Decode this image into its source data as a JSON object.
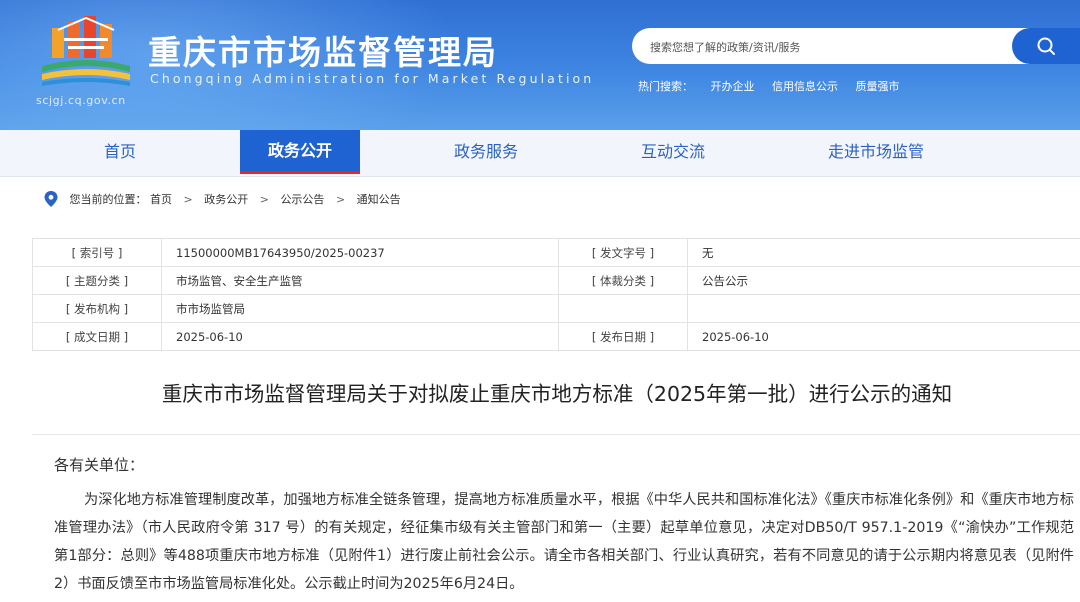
{
  "header": {
    "site_title": "重庆市市场监督管理局",
    "site_subtitle": "Chongqing Administration for Market Regulation",
    "site_url": "scjgj.cq.gov.cn",
    "logo_icon": "chongqing-city-logo-icon",
    "colors": {
      "header_blue": "#3f86e2",
      "button_blue": "#1f63d2",
      "active_underline": "#e22a22"
    }
  },
  "search": {
    "placeholder": "搜索您想了解的政策/资讯/服务",
    "value": "",
    "button_icon": "search-icon"
  },
  "hot_search": {
    "label": "热门搜索：",
    "items": [
      "开办企业",
      "信用信息公示",
      "质量强市"
    ]
  },
  "nav": {
    "items": [
      {
        "label": "首页",
        "active": false
      },
      {
        "label": "政务公开",
        "active": true
      },
      {
        "label": "政务服务",
        "active": false
      },
      {
        "label": "互动交流",
        "active": false
      },
      {
        "label": "走进市场监管",
        "active": false
      }
    ]
  },
  "breadcrumb": {
    "icon": "location-pin-icon",
    "prefix": "您当前的位置：",
    "items": [
      "首页",
      "政务公开",
      "公示公告",
      "通知公告"
    ],
    "separator": ">"
  },
  "meta": {
    "rows": [
      {
        "k1": "[ 索引号 ]",
        "v1": "11500000MB17643950/2025-00237",
        "k2": "[ 发文字号 ]",
        "v2": "无"
      },
      {
        "k1": "[ 主题分类 ]",
        "v1": "市场监管、安全生产监管",
        "k2": "[ 体裁分类 ]",
        "v2": "公告公示"
      },
      {
        "k1": "[ 发布机构 ]",
        "v1": "市市场监管局",
        "k2": "",
        "v2": ""
      },
      {
        "k1": "[ 成文日期 ]",
        "v1": "2025-06-10",
        "k2": "[ 发布日期 ]",
        "v2": "2025-06-10"
      }
    ]
  },
  "article": {
    "title": "重庆市市场监督管理局关于对拟废止重庆市地方标准（2025年第一批）进行公示的通知",
    "salutation": "各有关单位：",
    "paragraph": "为深化地方标准管理制度改革，加强地方标准全链条管理，提高地方标准质量水平，根据《中华人民共和国标准化法》《重庆市标准化条例》和《重庆市地方标准管理办法》（市人民政府令第 317 号）的有关规定，经征集市级有关主管部门和第一（主要）起草单位意见，决定对DB50/T 957.1-2019《“渝快办”工作规范 第1部分：总则》等488项重庆市地方标准（见附件1）进行废止前社会公示。请全市各相关部门、行业认真研究，若有不同意见的请于公示期内将意见表（见附件2）书面反馈至市市场监管局标准化处。公示截止时间为2025年6月24日。"
  }
}
